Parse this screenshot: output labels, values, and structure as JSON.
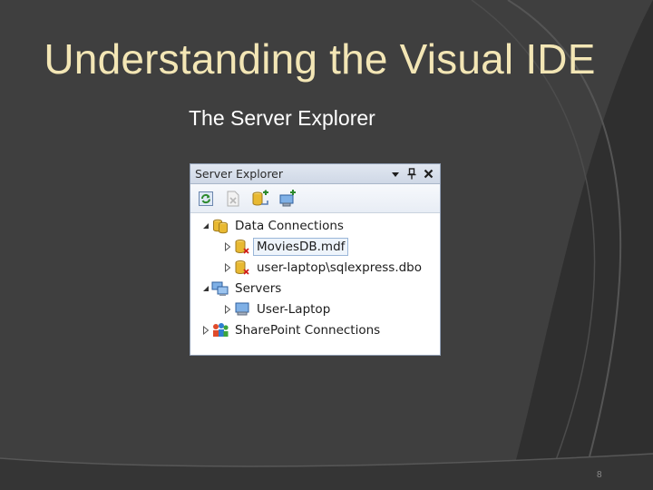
{
  "slide": {
    "title": "Understanding the Visual IDE",
    "subtitle": "The Server Explorer",
    "page_number": "8"
  },
  "server_explorer": {
    "title": "Server Explorer",
    "header_buttons": [
      "dropdown-arrow-icon",
      "pin-icon",
      "close-icon"
    ],
    "toolbar_buttons": [
      "refresh-icon",
      "stop-icon",
      "connect-to-database-icon",
      "connect-to-server-icon"
    ],
    "tree": [
      {
        "label": "Data Connections",
        "level": 0,
        "expanded": true,
        "icon": "data-connections-icon"
      },
      {
        "label": "MoviesDB.mdf",
        "level": 1,
        "expanded": false,
        "icon": "database-disconnected-icon",
        "selected": true
      },
      {
        "label": "user-laptop\\sqlexpress.dbo",
        "level": 1,
        "expanded": false,
        "icon": "database-disconnected-icon"
      },
      {
        "label": "Servers",
        "level": 0,
        "expanded": true,
        "icon": "servers-icon"
      },
      {
        "label": "User-Laptop",
        "level": 1,
        "expanded": false,
        "icon": "computer-icon"
      },
      {
        "label": "SharePoint Connections",
        "level": 0,
        "expanded": false,
        "icon": "sharepoint-icon"
      }
    ]
  }
}
